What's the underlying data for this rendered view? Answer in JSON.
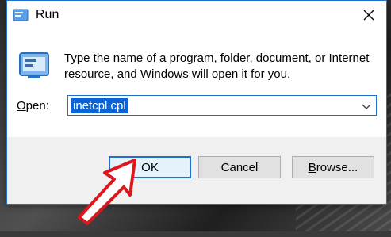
{
  "window": {
    "title": "Run",
    "app_icon": "run-icon",
    "close_icon": "close-icon"
  },
  "content": {
    "icon": "run-program-icon",
    "message": "Type the name of a program, folder, document, or Internet resource, and Windows will open it for you."
  },
  "open_field": {
    "label_hotkey": "O",
    "label_rest": "pen:",
    "value": "inetcpl.cpl",
    "dropdown_icon": "chevron-down-icon"
  },
  "buttons": {
    "ok": "OK",
    "cancel": "Cancel",
    "browse_hotkey": "B",
    "browse_rest": "rowse..."
  },
  "annotation": {
    "icon": "pointer-arrow-icon",
    "color": "#e0161d"
  },
  "colors": {
    "accent": "#1e6fd0",
    "selection": "#0a64d8"
  }
}
